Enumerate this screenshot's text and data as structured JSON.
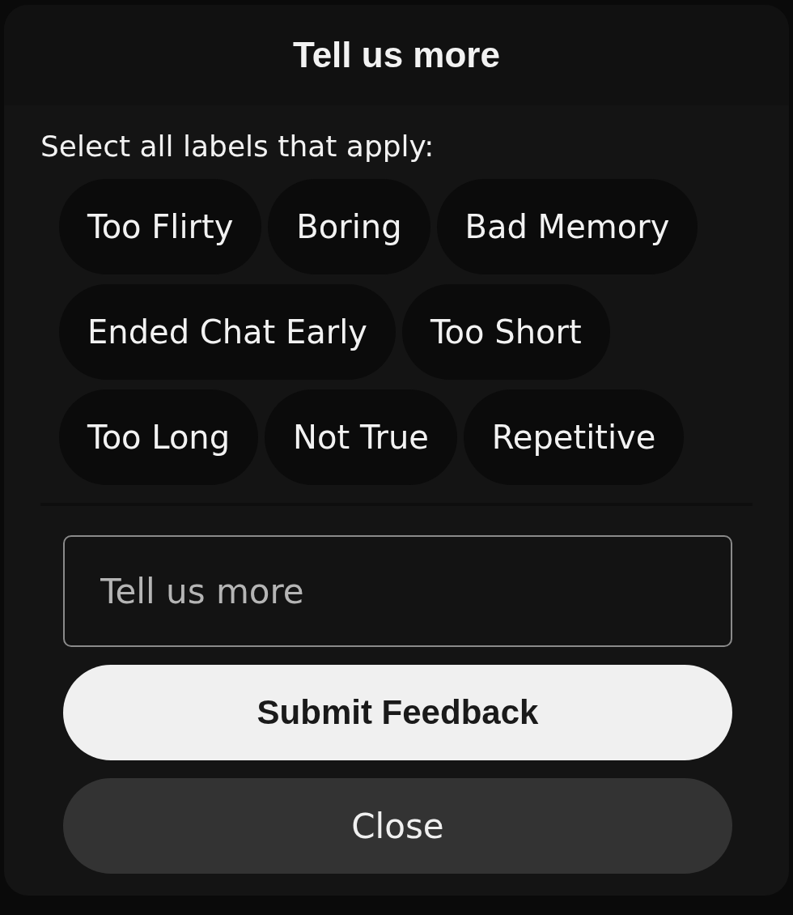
{
  "dialog": {
    "title": "Tell us more"
  },
  "prompt": "Select all labels that apply:",
  "label_rows": [
    [
      {
        "label": "Too Flirty",
        "selected": false
      },
      {
        "label": "Boring",
        "selected": false
      },
      {
        "label": "Bad Memory",
        "selected": false
      }
    ],
    [
      {
        "label": "Ended Chat Early",
        "selected": false
      },
      {
        "label": "Too Short",
        "selected": false
      }
    ],
    [
      {
        "label": "Too Long",
        "selected": false
      },
      {
        "label": "Not True",
        "selected": false
      },
      {
        "label": "Repetitive",
        "selected": false
      }
    ]
  ],
  "comment": {
    "placeholder": "Tell us more"
  },
  "buttons": [
    {
      "label": "Submit Feedback",
      "kind": "primary"
    },
    {
      "label": "Close",
      "kind": "secondary"
    }
  ]
}
